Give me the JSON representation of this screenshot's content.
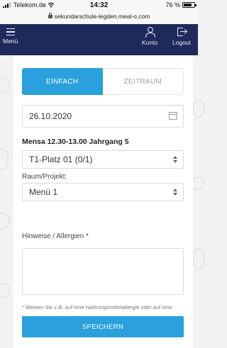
{
  "status_bar": {
    "carrier": "Telekom.de",
    "time": "14:32",
    "battery_percent": "76 %",
    "battery_level": 0.76,
    "url": "sekundarschule-legden.meal-o.com"
  },
  "navbar": {
    "menu_label": "Menü",
    "account_label": "Konto",
    "logout_label": "Logout"
  },
  "tabs": {
    "simple": "EINFACH",
    "period": "ZEITRAUM",
    "active": "simple"
  },
  "form": {
    "date_value": "26.10.2020",
    "section_title": "Mensa 12.30-13.00 Jahrgang 5",
    "seat_select_value": "T1-Platz 01 (0/1)",
    "room_label": "Raum/Projekt:",
    "room_select_value": "Menü 1",
    "notes_label": "Hinweise / Allergien *",
    "notes_value": "",
    "hint_text": "* Weisen Sie z.B. auf eine Nahrungsmittelallergie oder auf eine besondere Kostform hin.",
    "save_label": "SPEICHERN"
  },
  "colors": {
    "navbar": "#1f2a5c",
    "accent": "#2aa1dc",
    "background": "#f2f2f2"
  }
}
